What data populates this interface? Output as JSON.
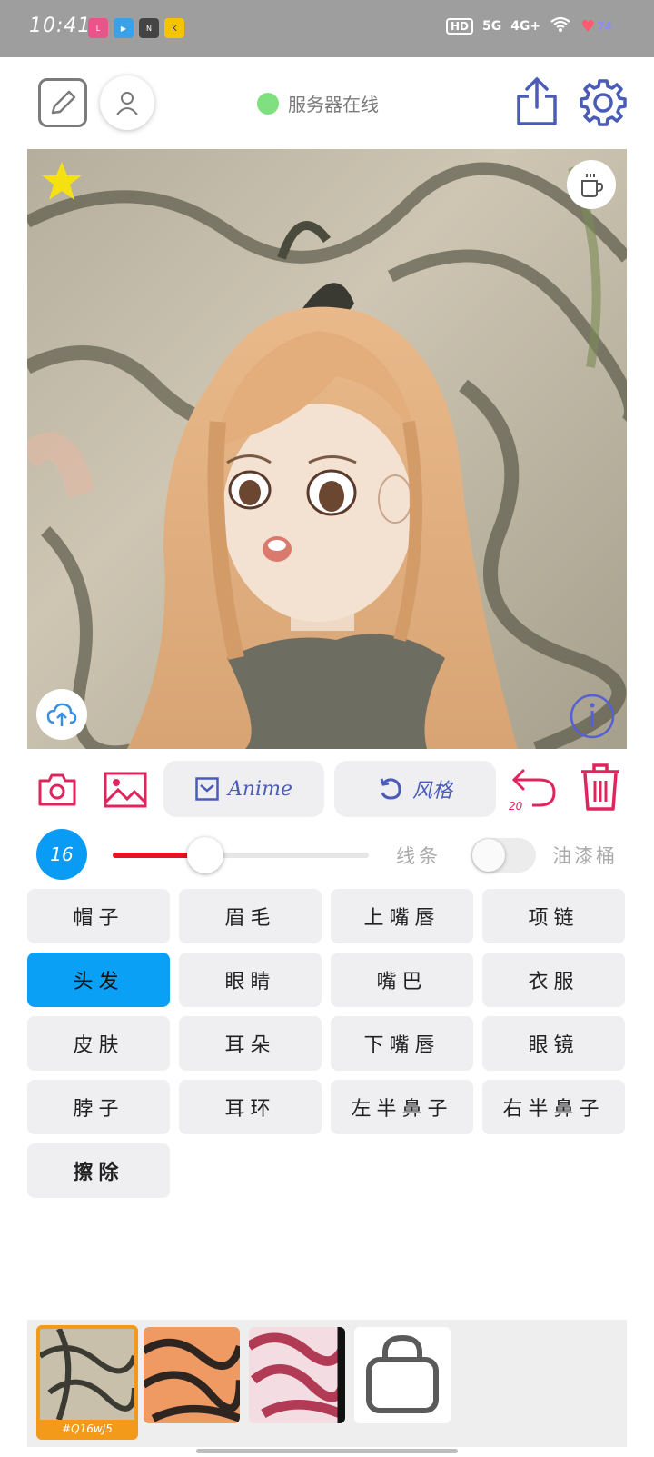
{
  "status_bar": {
    "time": "10:41",
    "app_icons": [
      "lofter",
      "video",
      "news",
      "kuaikan"
    ],
    "network": "5G",
    "network2": "4G+",
    "hd_label": "HD",
    "battery": "74"
  },
  "top_bar": {
    "server_status": "服务器在线",
    "server_status_color": "#7ee07e"
  },
  "canvas": {
    "icons": [
      "star-icon",
      "coffee-cup-icon",
      "cloud-upload-icon",
      "info-icon"
    ]
  },
  "toolbar": {
    "model_label": "Anime",
    "style_label": "风格",
    "undo_count": "20"
  },
  "brush": {
    "size": "16",
    "slider_fraction": 0.32,
    "line_label": "线条",
    "bucket_label": "油漆桶",
    "bucket_enabled": false,
    "accent_color": "#e8131d"
  },
  "parts": [
    {
      "label": "帽子",
      "active": false
    },
    {
      "label": "眉毛",
      "active": false
    },
    {
      "label": "上嘴唇",
      "active": false
    },
    {
      "label": "项链",
      "active": false
    },
    {
      "label": "头发",
      "active": true
    },
    {
      "label": "眼睛",
      "active": false
    },
    {
      "label": "嘴巴",
      "active": false
    },
    {
      "label": "衣服",
      "active": false
    },
    {
      "label": "皮肤",
      "active": false
    },
    {
      "label": "耳朵",
      "active": false
    },
    {
      "label": "下嘴唇",
      "active": false
    },
    {
      "label": "眼镜",
      "active": false
    },
    {
      "label": "脖子",
      "active": false
    },
    {
      "label": "耳环",
      "active": false
    },
    {
      "label": "左半鼻子",
      "active": false
    },
    {
      "label": "右半鼻子",
      "active": false
    },
    {
      "label": "擦除",
      "active": false
    }
  ],
  "styles": {
    "selected_code": "#Q16wJ5"
  }
}
